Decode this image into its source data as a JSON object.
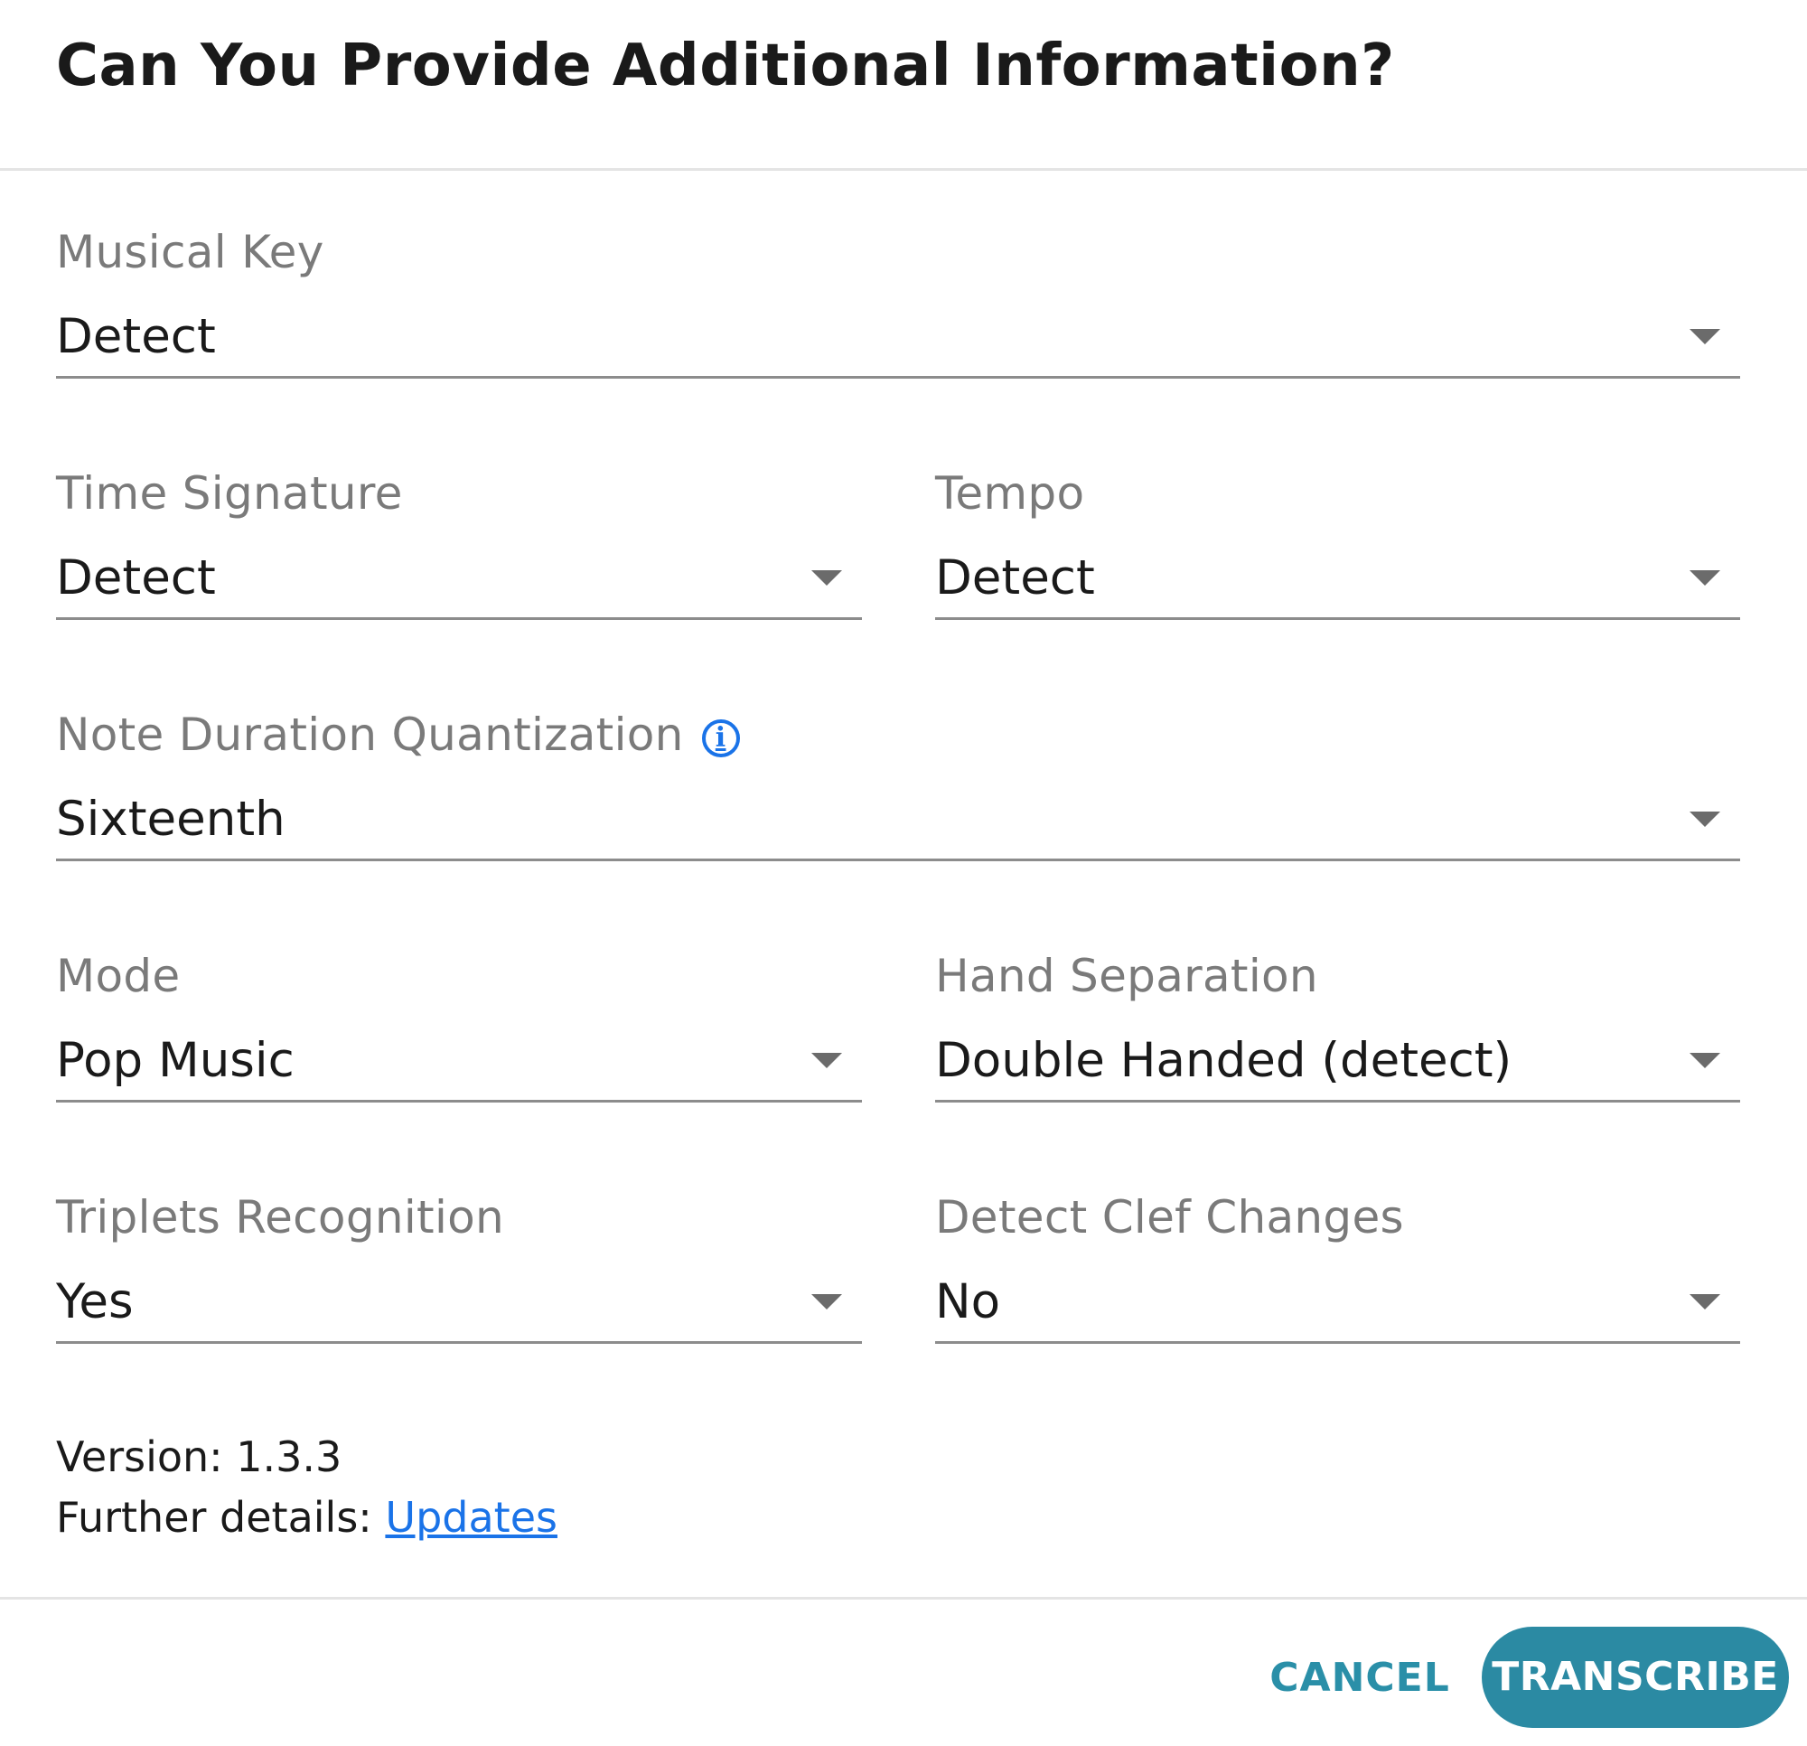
{
  "dialog": {
    "title": "Can You Provide Additional Information?"
  },
  "fields": {
    "musical_key": {
      "label": "Musical Key",
      "value": "Detect"
    },
    "time_signature": {
      "label": "Time Signature",
      "value": "Detect"
    },
    "tempo": {
      "label": "Tempo",
      "value": "Detect"
    },
    "note_duration": {
      "label": "Note Duration Quantization",
      "value": "Sixteenth",
      "info_icon": "info-icon"
    },
    "mode": {
      "label": "Mode",
      "value": "Pop Music"
    },
    "hand_separation": {
      "label": "Hand Separation",
      "value": "Double Handed (detect)"
    },
    "triplets": {
      "label": "Triplets Recognition",
      "value": "Yes"
    },
    "clef_changes": {
      "label": "Detect Clef Changes",
      "value": "No"
    }
  },
  "footer": {
    "version": "Version: 1.3.3",
    "details_prefix": "Further details: ",
    "details_link": "Updates"
  },
  "actions": {
    "cancel_label": "CANCEL",
    "transcribe_label": "TRANSCRIBE"
  },
  "colors": {
    "accent": "#2b8aa3",
    "link": "#1a73e8",
    "label": "#7a7a7a"
  }
}
